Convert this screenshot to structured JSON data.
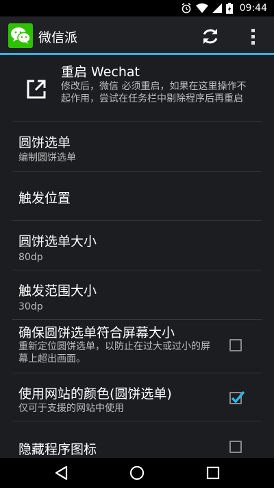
{
  "status_bar": {
    "time": "09:44",
    "icons": [
      "alarm-icon",
      "wifi-icon",
      "signal-icon",
      "battery-icon"
    ]
  },
  "app_bar": {
    "title": "微信派",
    "icon": "wechat-logo-icon",
    "actions": [
      "refresh-icon",
      "overflow-menu-icon"
    ]
  },
  "settings": {
    "restart": {
      "title": "重启 Wechat",
      "summary": "修改后，微信 必须重启，如果在这里操作不起作用，尝试在任务栏中剔除程序后再重启"
    },
    "pie_menu": {
      "title": "圆饼选单",
      "summary": "编制圆饼选单"
    },
    "trigger_position": {
      "title": "触发位置"
    },
    "pie_size": {
      "title": "圆饼选单大小",
      "summary": "80dp"
    },
    "trigger_range": {
      "title": "触发范围大小",
      "summary": "30dp"
    },
    "fit_screen": {
      "title": "确保圆饼选单符合屏幕大小",
      "summary": "重新定位圆饼选单，以防止在过大或过小的屏幕上超出画面。",
      "checked": false
    },
    "site_color": {
      "title": "使用网站的颜色(圆饼选单)",
      "summary": "仅可于支援的网站中使用",
      "checked": true
    },
    "hide_icon": {
      "title": "隐藏程序图标",
      "checked": false
    }
  },
  "colors": {
    "accent": "#33b5e5",
    "app_green": "#2dc100"
  }
}
